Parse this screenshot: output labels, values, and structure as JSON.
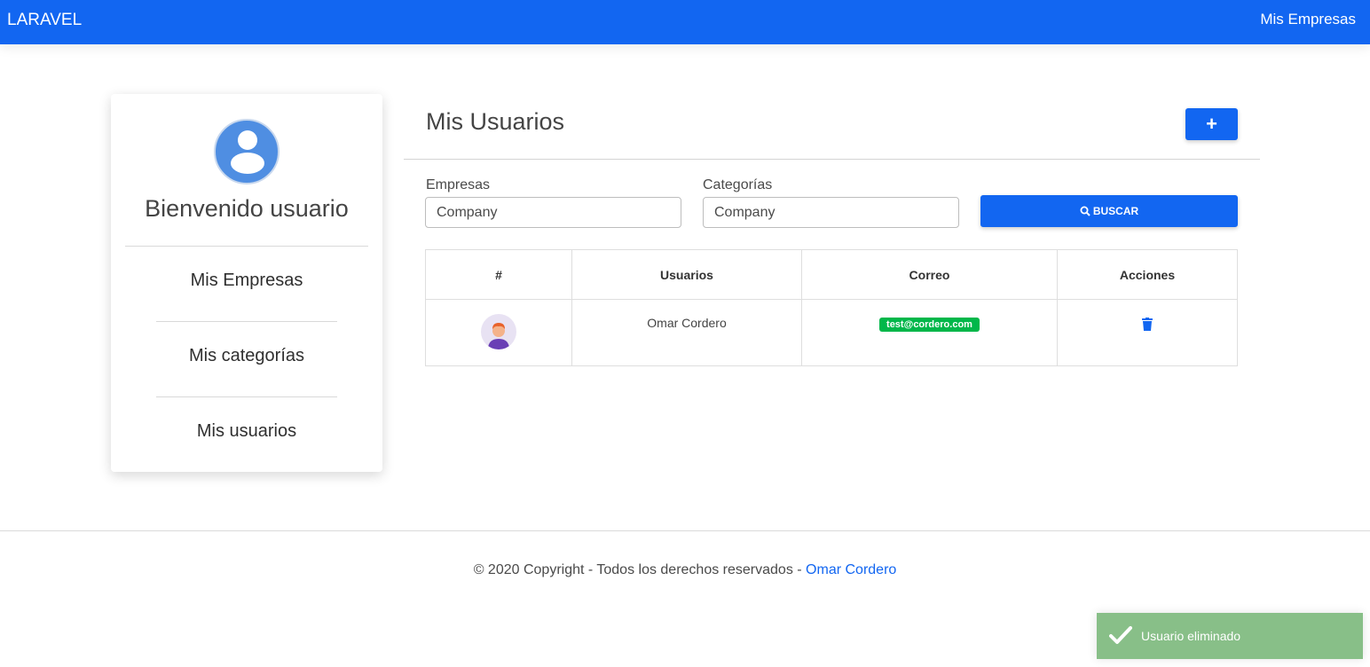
{
  "navbar": {
    "brand": "LARAVEL",
    "link": "Mis Empresas"
  },
  "sidebar": {
    "welcome": "Bienvenido usuario",
    "items": [
      {
        "label": "Mis Empresas"
      },
      {
        "label": "Mis categorías"
      },
      {
        "label": "Mis usuarios"
      }
    ]
  },
  "main": {
    "title": "Mis Usuarios",
    "add_label": "+",
    "filters": {
      "empresas_label": "Empresas",
      "empresas_value": "Company",
      "categorias_label": "Categorías",
      "categorias_value": "Company",
      "search_label": "BUSCAR"
    },
    "table": {
      "headers": [
        "#",
        "Usuarios",
        "Correo",
        "Acciones"
      ],
      "rows": [
        {
          "name": "Omar Cordero",
          "email": "test@cordero.com"
        }
      ]
    }
  },
  "footer": {
    "text": "© 2020 Copyright - Todos los derechos reservados - ",
    "link": "Omar Cordero"
  },
  "toast": {
    "message": "Usuario eliminado"
  },
  "colors": {
    "primary": "#1266f1",
    "success": "#00b74a",
    "toast": "#88bf88"
  }
}
